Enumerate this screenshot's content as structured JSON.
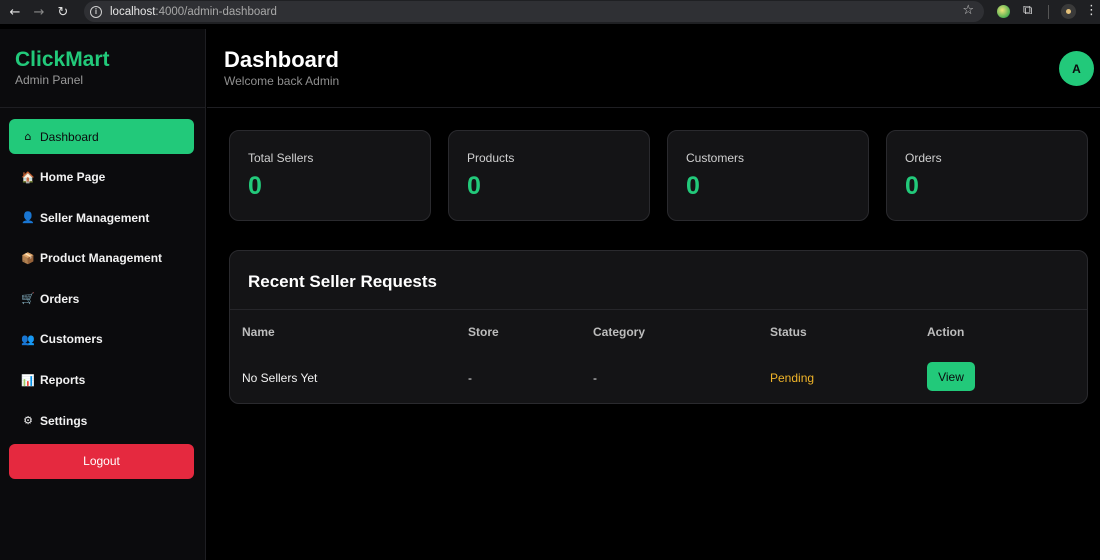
{
  "browser": {
    "url_host": "localhost",
    "url_path": ":4000/admin-dashboard"
  },
  "sidebar": {
    "brand": "ClickMart",
    "subtitle": "Admin Panel",
    "items": [
      {
        "label": "Dashboard",
        "icon": "home-icon",
        "glyph": "⌂"
      },
      {
        "label": "Home Page",
        "icon": "house-icon",
        "glyph": "🏠"
      },
      {
        "label": "Seller Management",
        "icon": "user-icon",
        "glyph": "👤"
      },
      {
        "label": "Product Management",
        "icon": "package-icon",
        "glyph": "📦"
      },
      {
        "label": "Orders",
        "icon": "cart-icon",
        "glyph": "🛒"
      },
      {
        "label": "Customers",
        "icon": "users-icon",
        "glyph": "👥"
      },
      {
        "label": "Reports",
        "icon": "bar-chart-icon",
        "glyph": "📊"
      },
      {
        "label": "Settings",
        "icon": "gear-icon",
        "glyph": "⚙"
      }
    ],
    "logout": "Logout"
  },
  "header": {
    "title": "Dashboard",
    "subtitle": "Welcome back Admin",
    "avatar_initial": "A"
  },
  "stats": [
    {
      "label": "Total Sellers",
      "value": "0"
    },
    {
      "label": "Products",
      "value": "0"
    },
    {
      "label": "Customers",
      "value": "0"
    },
    {
      "label": "Orders",
      "value": "0"
    }
  ],
  "requests": {
    "title": "Recent Seller Requests",
    "columns": [
      "Name",
      "Store",
      "Category",
      "Status",
      "Action"
    ],
    "rows": [
      {
        "name": "No Sellers Yet",
        "store": "-",
        "category": "-",
        "status": "Pending",
        "action": "View"
      }
    ]
  },
  "colors": {
    "accent": "#22c97a",
    "danger": "#e5293f",
    "pending": "#f0b429"
  }
}
